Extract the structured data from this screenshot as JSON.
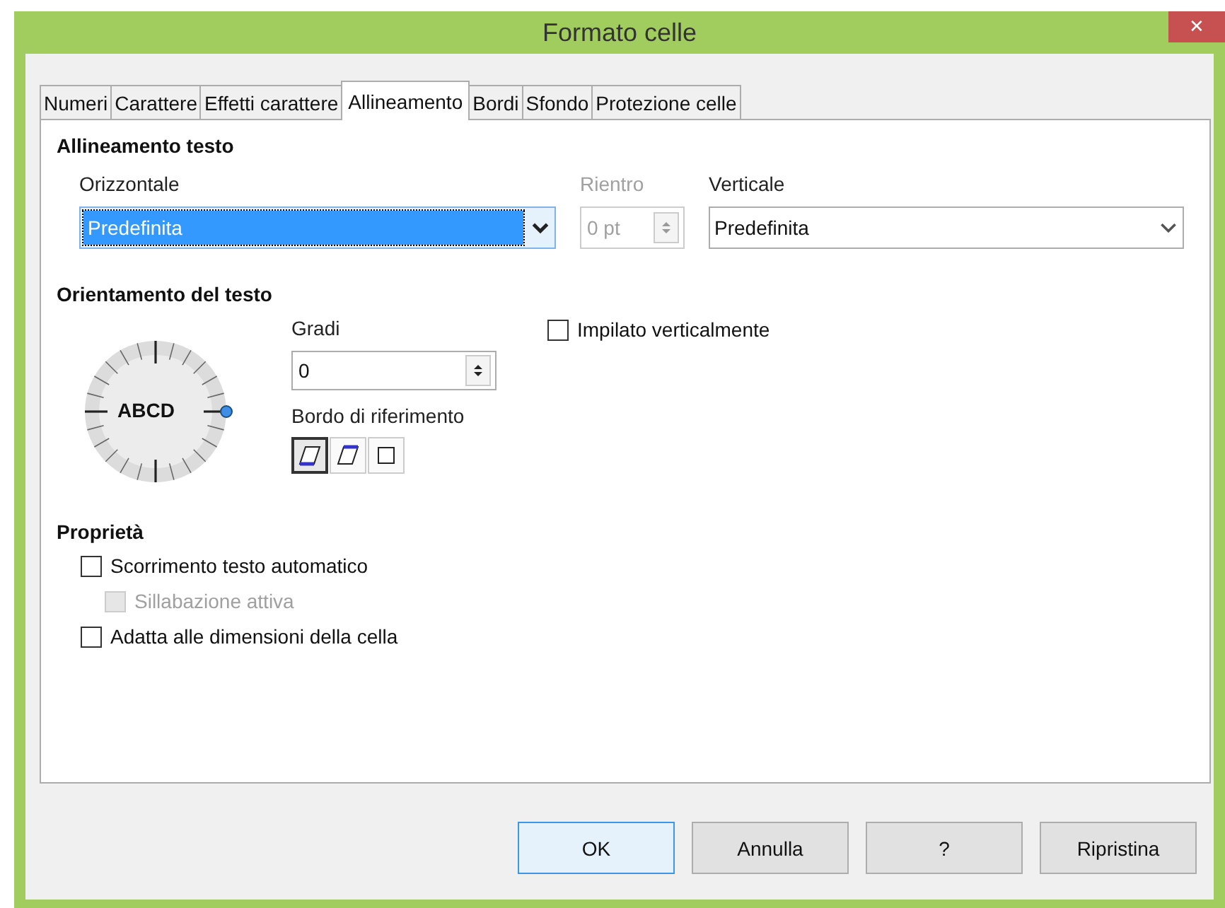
{
  "window": {
    "title": "Formato celle",
    "close": "✕"
  },
  "tabs": [
    {
      "label": "Numeri",
      "selected": false
    },
    {
      "label": "Carattere",
      "selected": false
    },
    {
      "label": "Effetti carattere",
      "selected": false
    },
    {
      "label": "Allineamento",
      "selected": true
    },
    {
      "label": "Bordi",
      "selected": false
    },
    {
      "label": "Sfondo",
      "selected": false
    },
    {
      "label": "Protezione celle",
      "selected": false
    }
  ],
  "text_alignment": {
    "heading": "Allineamento testo",
    "horizontal": {
      "label": "Orizzontale",
      "value": "Predefinita",
      "focused": true
    },
    "indent": {
      "label": "Rientro",
      "value": "0 pt",
      "disabled": true
    },
    "vertical": {
      "label": "Verticale",
      "value": "Predefinita",
      "focused": false
    }
  },
  "text_orientation": {
    "heading": "Orientamento del testo",
    "dial_text": "ABCD",
    "degrees": {
      "label": "Gradi",
      "value": "0"
    },
    "reference_edge": {
      "label": "Bordo di riferimento",
      "options": [
        {
          "kind": "bottom",
          "selected": true
        },
        {
          "kind": "top",
          "selected": false
        },
        {
          "kind": "inside",
          "selected": false
        }
      ]
    },
    "stacked": {
      "label": "Impilato verticalmente",
      "checked": false,
      "disabled": false
    }
  },
  "properties": {
    "heading": "Proprietà",
    "options": [
      {
        "label": "Scorrimento testo automatico",
        "checked": false,
        "disabled": false,
        "children": [
          {
            "label": "Sillabazione attiva",
            "checked": false,
            "disabled": true
          }
        ]
      },
      {
        "label": "Adatta alle dimensioni della cella",
        "checked": false,
        "disabled": false
      }
    ]
  },
  "buttons": [
    {
      "label": "OK",
      "default": true
    },
    {
      "label": "Annulla",
      "default": false
    },
    {
      "label": "?",
      "default": false
    },
    {
      "label": "Ripristina",
      "default": false
    }
  ]
}
